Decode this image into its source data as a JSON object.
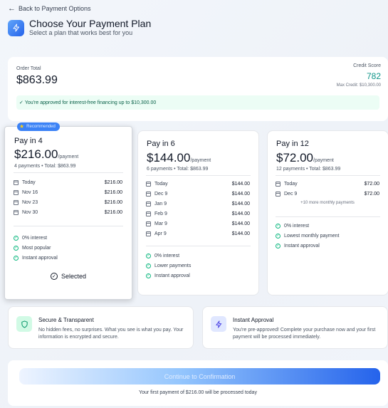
{
  "nav": {
    "back_label": "Back to Payment Options"
  },
  "header": {
    "title": "Choose Your Payment Plan",
    "subtitle": "Select a plan that works best for you"
  },
  "summary": {
    "order_label": "Order Total",
    "order_total": "$863.99",
    "credit_label": "Credit Score",
    "credit_score": "782",
    "max_credit": "Max Credit: $10,300.00",
    "approval_text": "You're approved for interest-free financing up to $10,300.00"
  },
  "plans": [
    {
      "name": "Pay in 4",
      "price": "$216.00",
      "unit": "/payment",
      "meta": "4 payments • Total: $863.99",
      "badge": "Recommended",
      "schedule": [
        {
          "date": "Today",
          "amount": "$216.00"
        },
        {
          "date": "Nov 16",
          "amount": "$216.00"
        },
        {
          "date": "Nov 23",
          "amount": "$216.00"
        },
        {
          "date": "Nov 30",
          "amount": "$216.00"
        }
      ],
      "features": [
        "0% interest",
        "Most popular",
        "Instant approval"
      ],
      "selected_label": "Selected"
    },
    {
      "name": "Pay in 6",
      "price": "$144.00",
      "unit": "/payment",
      "meta": "6 payments • Total: $863.99",
      "schedule": [
        {
          "date": "Today",
          "amount": "$144.00"
        },
        {
          "date": "Dec 9",
          "amount": "$144.00"
        },
        {
          "date": "Jan 9",
          "amount": "$144.00"
        },
        {
          "date": "Feb 9",
          "amount": "$144.00"
        },
        {
          "date": "Mar 9",
          "amount": "$144.00"
        },
        {
          "date": "Apr 9",
          "amount": "$144.00"
        }
      ],
      "features": [
        "0% interest",
        "Lower payments",
        "Instant approval"
      ]
    },
    {
      "name": "Pay in 12",
      "price": "$72.00",
      "unit": "/payment",
      "meta": "12 payments • Total: $863.99",
      "schedule": [
        {
          "date": "Today",
          "amount": "$72.00"
        },
        {
          "date": "Dec 9",
          "amount": "$72.00"
        }
      ],
      "more_note": "+10 more monthly payments",
      "features": [
        "0% interest",
        "Lowest monthly payment",
        "Instant approval"
      ]
    }
  ],
  "info": [
    {
      "title": "Secure & Transparent",
      "text": "No hidden fees, no surprises. What you see is what you pay. Your information is encrypted and secure.",
      "icon": "shield-icon"
    },
    {
      "title": "Instant Approval",
      "text": "You're pre-approved! Complete your purchase now and your first payment will be processed immediately.",
      "icon": "lightning-icon"
    }
  ],
  "footer": {
    "continue_label": "Continue to Confirmation",
    "note": "Your first payment of $216.00 will be processed today"
  },
  "colors": {
    "accent": "#2563eb",
    "success": "#10b981",
    "credit": "#0d9488"
  }
}
